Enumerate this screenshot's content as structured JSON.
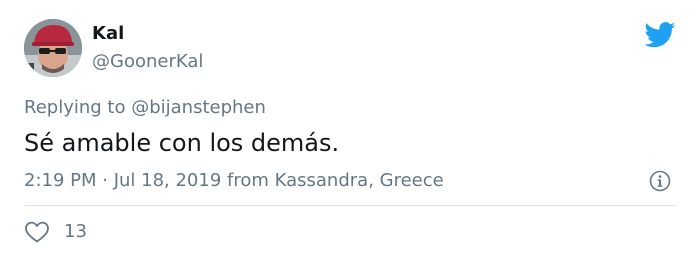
{
  "tweet": {
    "author": {
      "display_name": "Kal",
      "handle": "@GoonerKal"
    },
    "replying_prefix": "Replying to ",
    "replying_to": "@bijanstephen",
    "text": "Sé amable con los demás.",
    "meta": "2:19 PM · Jul 18, 2019 from Kassandra, Greece",
    "likes": "13"
  },
  "icons": {
    "logo": "twitter-bird-icon",
    "info": "info-icon",
    "like": "heart-icon"
  },
  "colors": {
    "brand": "#1da1f2",
    "text_primary": "#14171a",
    "text_secondary": "#657786",
    "divider": "#e1e8ed",
    "background": "#ffffff"
  }
}
